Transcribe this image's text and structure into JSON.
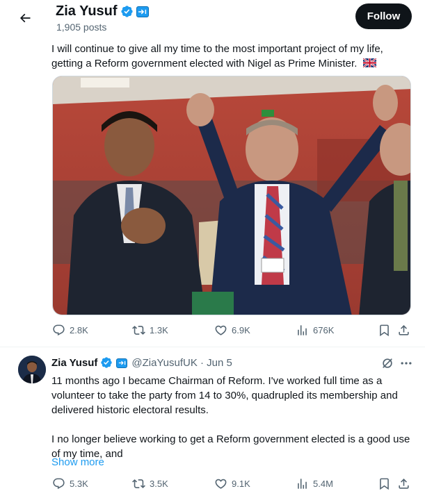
{
  "header": {
    "name": "Zia Yusuf",
    "post_count": "1,905 posts",
    "follow_label": "Follow"
  },
  "post": {
    "text": "I will continue to give all my time to the most important project of my life, getting a Reform government elected with Nigel as Prime Minister.",
    "flag_emoji": "🇬🇧",
    "actions": {
      "replies": "2.8K",
      "reposts": "1.3K",
      "likes": "6.9K",
      "views": "676K"
    }
  },
  "quoted": {
    "name": "Zia Yusuf",
    "handle_date": "@ZiaYusufUK · Jun 5",
    "paragraph1": "11 months ago I became Chairman of Reform. I've worked full time as a volunteer to take the party from 14 to 30%, quadrupled its membership and delivered historic electoral results.",
    "paragraph2": "I no longer believe working to get a Reform government elected is a good use of my time, and",
    "show_more": "Show more",
    "actions": {
      "replies": "5.3K",
      "reposts": "3.5K",
      "likes": "9.1K",
      "views": "5.4M"
    }
  },
  "colors": {
    "accent": "#1d9bf0",
    "text_primary": "#0f1419",
    "text_secondary": "#536471",
    "follow_bg": "#0f1419"
  },
  "icons": [
    "back-arrow-icon",
    "verified-badge-icon",
    "affiliation-badge-icon",
    "reply-icon",
    "repost-icon",
    "like-icon",
    "views-icon",
    "bookmark-icon",
    "share-icon",
    "grok-icon",
    "more-icon"
  ]
}
